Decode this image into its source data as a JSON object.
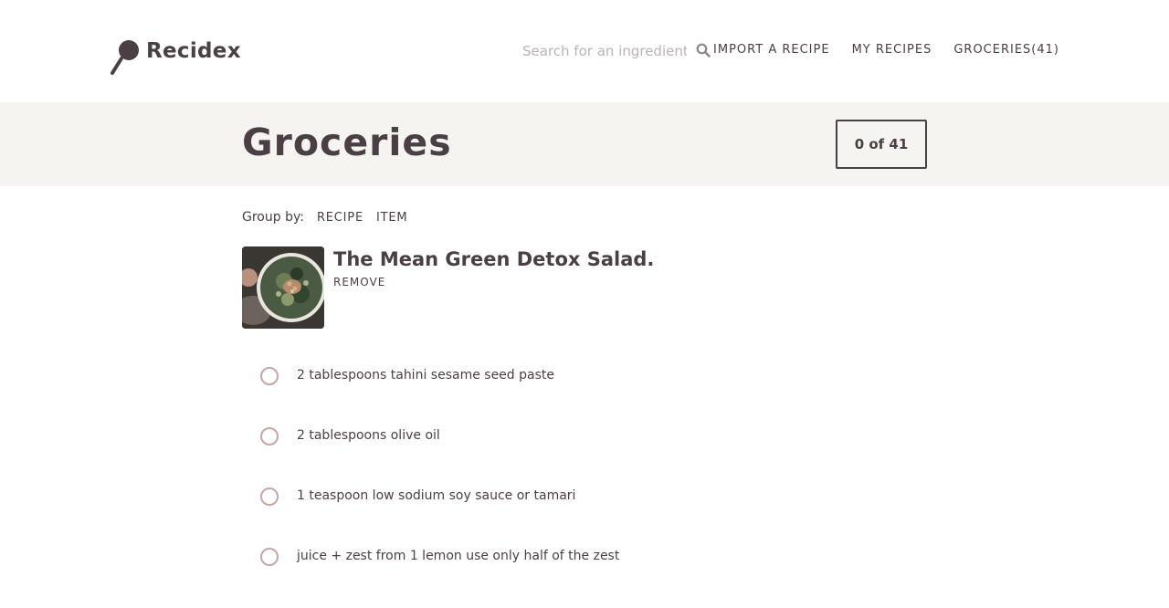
{
  "brand": {
    "name": "Recidex"
  },
  "search": {
    "placeholder": "Search for an ingredient",
    "value": ""
  },
  "nav": {
    "import": "IMPORT A RECIPE",
    "my_recipes": "MY RECIPES",
    "groceries": "GROCERIES(41)"
  },
  "page": {
    "title": "Groceries",
    "counter": "0 of 41"
  },
  "group_by": {
    "label": "Group by:",
    "options": [
      "RECIPE",
      "ITEM"
    ]
  },
  "recipe": {
    "title": "The Mean Green Detox Salad.",
    "remove_label": "REMOVE",
    "ingredients": [
      {
        "text": "2 tablespoons tahini sesame seed paste",
        "checked": false
      },
      {
        "text": "2 tablespoons olive oil",
        "checked": false
      },
      {
        "text": "1 teaspoon low sodium soy sauce or tamari",
        "checked": false
      },
      {
        "text": "juice + zest from 1 lemon use only half of the zest",
        "checked": false
      }
    ]
  },
  "colors": {
    "text": "#4a3f44",
    "banner_bg": "#f6f4f0",
    "checkbox_border": "#c5a6a7",
    "placeholder": "#b9b3b5"
  },
  "icons": {
    "logo": "frying-pan-icon",
    "search": "search-icon"
  }
}
